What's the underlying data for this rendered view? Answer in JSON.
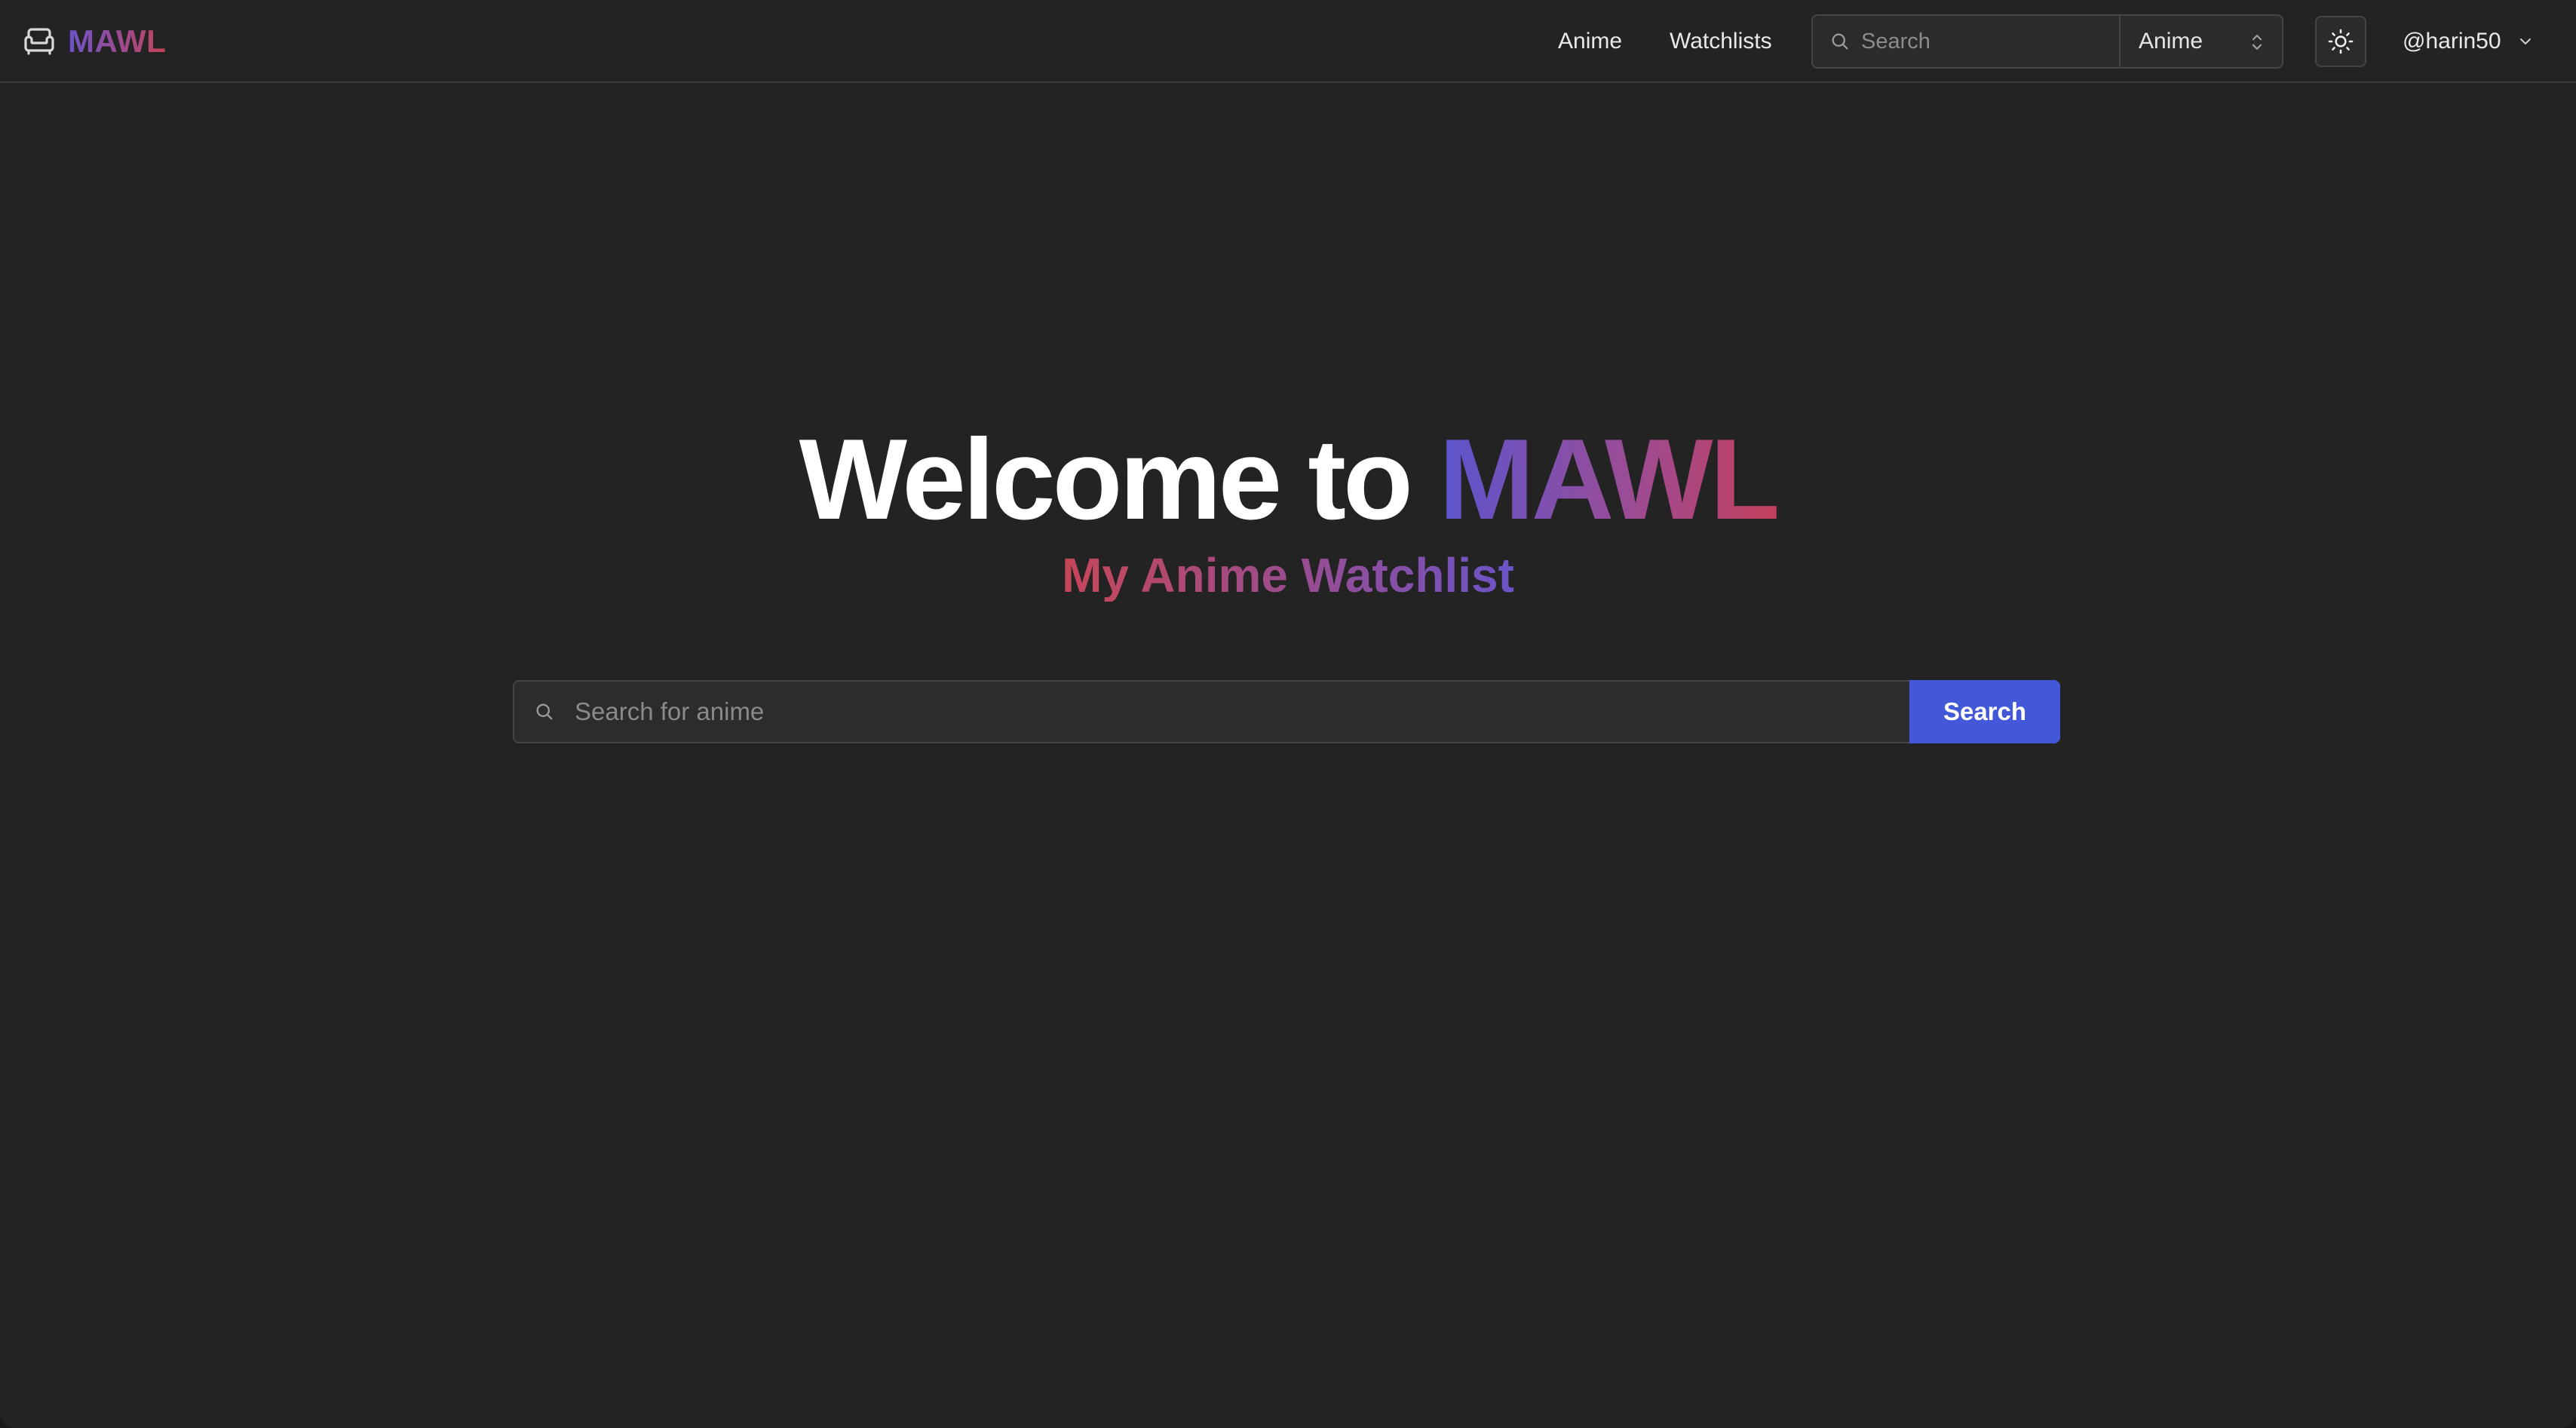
{
  "navbar": {
    "brand": {
      "icon": "armchair-icon",
      "name": "MAWL"
    },
    "links": [
      {
        "label": "Anime"
      },
      {
        "label": "Watchlists"
      }
    ],
    "search": {
      "placeholder": "Search",
      "icon": "search-icon",
      "category": "Anime"
    },
    "theme_toggle": {
      "icon": "sun-icon"
    },
    "user": {
      "handle": "@harin50"
    }
  },
  "hero": {
    "title_prefix": "Welcome to",
    "title_brand": "MAWL",
    "subtitle": "My Anime Watchlist"
  },
  "main_search": {
    "placeholder": "Search for anime",
    "button_label": "Search"
  },
  "colors": {
    "background": "#232323",
    "accent_button": "#4258d8",
    "brand_gradient": [
      "#5a55cf",
      "#9a4c97",
      "#c43f5c"
    ],
    "subtitle_gradient": [
      "#c64657",
      "#8a4fa4",
      "#6a54c8"
    ]
  }
}
